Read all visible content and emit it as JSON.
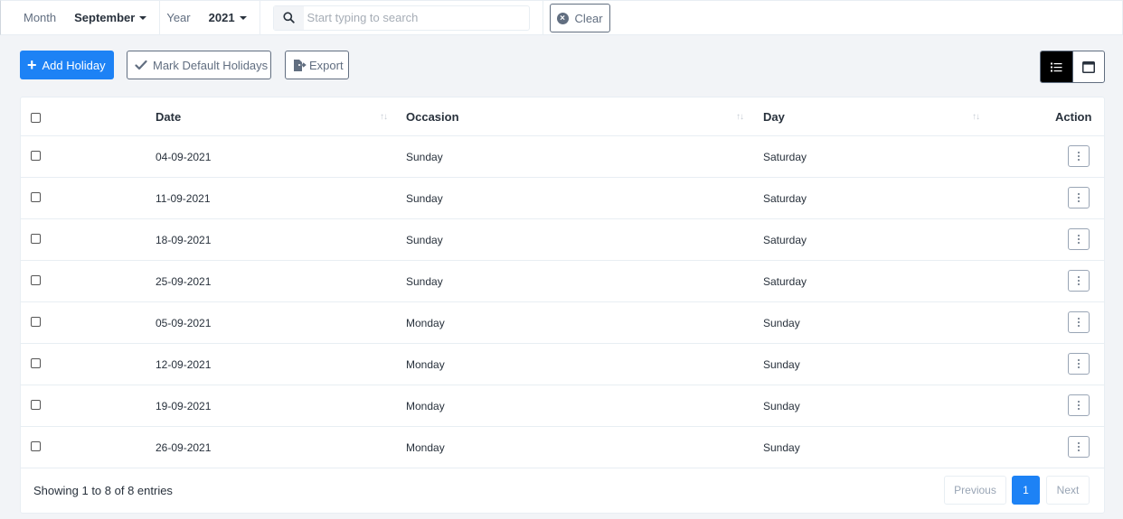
{
  "filters": {
    "month_label": "Month",
    "month_value": "September",
    "year_label": "Year",
    "year_value": "2021",
    "search_placeholder": "Start typing to search",
    "clear_label": "Clear"
  },
  "actions": {
    "add_label": "Add Holiday",
    "mark_default_label": "Mark Default Holidays",
    "export_label": "Export"
  },
  "view_toggle": {
    "active": "list"
  },
  "table": {
    "headers": {
      "date": "Date",
      "occasion": "Occasion",
      "day": "Day",
      "action": "Action"
    },
    "rows": [
      {
        "date": "04-09-2021",
        "occasion": "Sunday",
        "day": "Saturday"
      },
      {
        "date": "11-09-2021",
        "occasion": "Sunday",
        "day": "Saturday"
      },
      {
        "date": "18-09-2021",
        "occasion": "Sunday",
        "day": "Saturday"
      },
      {
        "date": "25-09-2021",
        "occasion": "Sunday",
        "day": "Saturday"
      },
      {
        "date": "05-09-2021",
        "occasion": "Monday",
        "day": "Sunday"
      },
      {
        "date": "12-09-2021",
        "occasion": "Monday",
        "day": "Sunday"
      },
      {
        "date": "19-09-2021",
        "occasion": "Monday",
        "day": "Sunday"
      },
      {
        "date": "26-09-2021",
        "occasion": "Monday",
        "day": "Sunday"
      }
    ]
  },
  "footer": {
    "info": "Showing 1 to 8 of 8 entries",
    "previous": "Previous",
    "page": "1",
    "next": "Next"
  },
  "colors": {
    "primary": "#1d82f5",
    "text": "#28313c",
    "muted": "#616e80",
    "background": "#f2f4f7"
  }
}
